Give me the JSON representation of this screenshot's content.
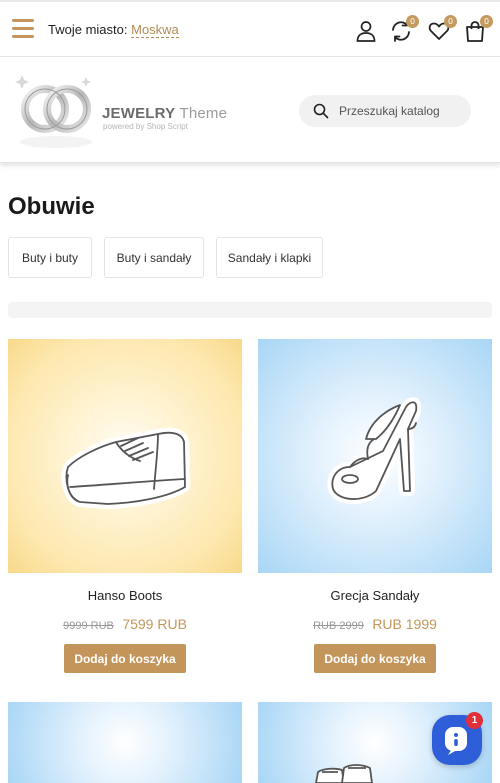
{
  "topbar": {
    "city_label": "Twoje miasto:",
    "city_value": "Moskwa",
    "compare_count": "0",
    "wishlist_count": "0",
    "cart_count": "0"
  },
  "header": {
    "logo_title": "JEWELRY",
    "logo_title_suffix": "Theme",
    "logo_subtitle": "powered by Shop Script",
    "search_placeholder": "Przeszukaj katalog"
  },
  "page": {
    "title": "Obuwie",
    "categories": [
      "Buty i buty",
      "Buty i sandały",
      "Sandały i klapki"
    ]
  },
  "products": [
    {
      "name": "Hanso Boots",
      "price_old": "9999 RUB",
      "price_new": "7599 RUB",
      "button": "Dodaj do koszyka"
    },
    {
      "name": "Grecja Sandały",
      "price_old": "RUB 2999",
      "price_new": "RUB 1999",
      "button": "Dodaj do koszyka"
    }
  ],
  "chat": {
    "badge": "1"
  },
  "colors": {
    "accent": "#c4955a",
    "chat": "#2e5fd8",
    "chat_badge": "#e0303a"
  }
}
